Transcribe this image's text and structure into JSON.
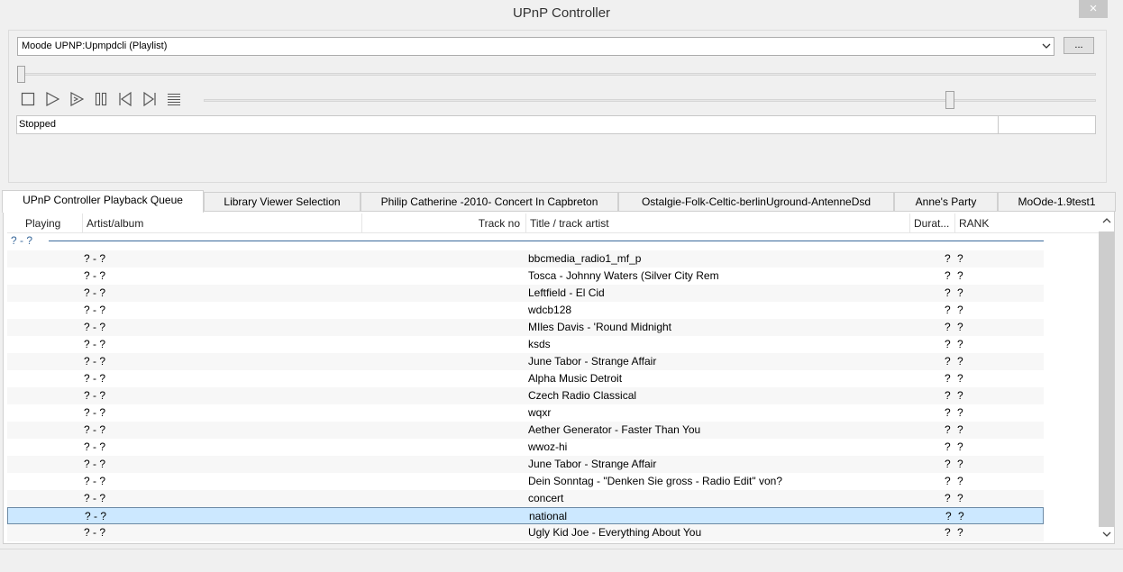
{
  "window": {
    "title": "UPnP Controller",
    "close_label": "×"
  },
  "controller": {
    "renderer": "Moode UPNP:Upmpdcli (Playlist)",
    "more_label": "...",
    "seek_position": 0.0,
    "volume_level": 0.84,
    "status": "Stopped",
    "transport_icons": [
      "stop-icon",
      "play-icon",
      "play-next-icon",
      "pause-icon",
      "previous-icon",
      "next-icon",
      "playlist-icon"
    ]
  },
  "tabs": [
    {
      "label": "UPnP Controller Playback Queue",
      "active": true
    },
    {
      "label": "Library Viewer Selection",
      "active": false
    },
    {
      "label": "Philip Catherine -2010- Concert In Capbreton",
      "active": false
    },
    {
      "label": "Ostalgie-Folk-Celtic-berlinUground-AntenneDsd",
      "active": false
    },
    {
      "label": "Anne's Party",
      "active": false
    },
    {
      "label": "MoOde-1.9test1",
      "active": false
    }
  ],
  "table": {
    "columns": [
      "Playing",
      "Artist/album",
      "Track no",
      "Title / track artist",
      "Durat...",
      "RANK"
    ],
    "group_label": "? - ?",
    "rows": [
      {
        "artist": "? - ?",
        "title": "bbcmedia_radio1_mf_p",
        "duration": "?",
        "rank": "?"
      },
      {
        "artist": "? - ?",
        "title": "Tosca - Johnny Waters (Silver City Rem",
        "duration": "?",
        "rank": "?"
      },
      {
        "artist": "? - ?",
        "title": "Leftfield - El Cid",
        "duration": "?",
        "rank": "?"
      },
      {
        "artist": "? - ?",
        "title": "wdcb128",
        "duration": "?",
        "rank": "?"
      },
      {
        "artist": "? - ?",
        "title": "MIles Davis - 'Round Midnight",
        "duration": "?",
        "rank": "?"
      },
      {
        "artist": "? - ?",
        "title": "ksds",
        "duration": "?",
        "rank": "?"
      },
      {
        "artist": "? - ?",
        "title": "June Tabor - Strange Affair",
        "duration": "?",
        "rank": "?"
      },
      {
        "artist": "? - ?",
        "title": "Alpha Music Detroit",
        "duration": "?",
        "rank": "?"
      },
      {
        "artist": "? - ?",
        "title": "Czech Radio Classical",
        "duration": "?",
        "rank": "?"
      },
      {
        "artist": "? - ?",
        "title": "wqxr",
        "duration": "?",
        "rank": "?"
      },
      {
        "artist": "? - ?",
        "title": "Aether Generator - Faster Than You",
        "duration": "?",
        "rank": "?"
      },
      {
        "artist": "? - ?",
        "title": "wwoz-hi",
        "duration": "?",
        "rank": "?"
      },
      {
        "artist": "? - ?",
        "title": "June Tabor - Strange Affair",
        "duration": "?",
        "rank": "?"
      },
      {
        "artist": "? - ?",
        "title": "Dein Sonntag - \"Denken Sie gross - Radio Edit\" von?",
        "duration": "?",
        "rank": "?"
      },
      {
        "artist": "? - ?",
        "title": "concert",
        "duration": "?",
        "rank": "?"
      },
      {
        "artist": "? - ?",
        "title": "national",
        "duration": "?",
        "rank": "?",
        "selected": true
      },
      {
        "artist": "? - ?",
        "title": "Ugly Kid Joe - Everything About You",
        "duration": "?",
        "rank": "?"
      }
    ]
  }
}
